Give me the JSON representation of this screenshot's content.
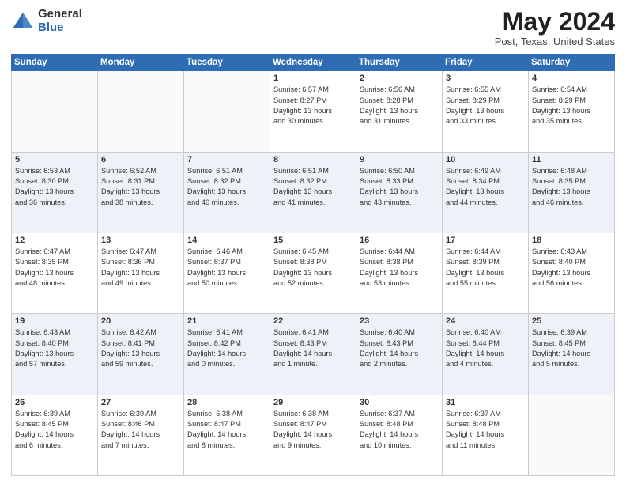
{
  "logo": {
    "general": "General",
    "blue": "Blue"
  },
  "title": {
    "month_year": "May 2024",
    "location": "Post, Texas, United States"
  },
  "days_of_week": [
    "Sunday",
    "Monday",
    "Tuesday",
    "Wednesday",
    "Thursday",
    "Friday",
    "Saturday"
  ],
  "weeks": [
    [
      {
        "day": "",
        "info": ""
      },
      {
        "day": "",
        "info": ""
      },
      {
        "day": "",
        "info": ""
      },
      {
        "day": "1",
        "info": "Sunrise: 6:57 AM\nSunset: 8:27 PM\nDaylight: 13 hours\nand 30 minutes."
      },
      {
        "day": "2",
        "info": "Sunrise: 6:56 AM\nSunset: 8:28 PM\nDaylight: 13 hours\nand 31 minutes."
      },
      {
        "day": "3",
        "info": "Sunrise: 6:55 AM\nSunset: 8:29 PM\nDaylight: 13 hours\nand 33 minutes."
      },
      {
        "day": "4",
        "info": "Sunrise: 6:54 AM\nSunset: 8:29 PM\nDaylight: 13 hours\nand 35 minutes."
      }
    ],
    [
      {
        "day": "5",
        "info": "Sunrise: 6:53 AM\nSunset: 8:30 PM\nDaylight: 13 hours\nand 36 minutes."
      },
      {
        "day": "6",
        "info": "Sunrise: 6:52 AM\nSunset: 8:31 PM\nDaylight: 13 hours\nand 38 minutes."
      },
      {
        "day": "7",
        "info": "Sunrise: 6:51 AM\nSunset: 8:32 PM\nDaylight: 13 hours\nand 40 minutes."
      },
      {
        "day": "8",
        "info": "Sunrise: 6:51 AM\nSunset: 8:32 PM\nDaylight: 13 hours\nand 41 minutes."
      },
      {
        "day": "9",
        "info": "Sunrise: 6:50 AM\nSunset: 8:33 PM\nDaylight: 13 hours\nand 43 minutes."
      },
      {
        "day": "10",
        "info": "Sunrise: 6:49 AM\nSunset: 8:34 PM\nDaylight: 13 hours\nand 44 minutes."
      },
      {
        "day": "11",
        "info": "Sunrise: 6:48 AM\nSunset: 8:35 PM\nDaylight: 13 hours\nand 46 minutes."
      }
    ],
    [
      {
        "day": "12",
        "info": "Sunrise: 6:47 AM\nSunset: 8:35 PM\nDaylight: 13 hours\nand 48 minutes."
      },
      {
        "day": "13",
        "info": "Sunrise: 6:47 AM\nSunset: 8:36 PM\nDaylight: 13 hours\nand 49 minutes."
      },
      {
        "day": "14",
        "info": "Sunrise: 6:46 AM\nSunset: 8:37 PM\nDaylight: 13 hours\nand 50 minutes."
      },
      {
        "day": "15",
        "info": "Sunrise: 6:45 AM\nSunset: 8:38 PM\nDaylight: 13 hours\nand 52 minutes."
      },
      {
        "day": "16",
        "info": "Sunrise: 6:44 AM\nSunset: 8:38 PM\nDaylight: 13 hours\nand 53 minutes."
      },
      {
        "day": "17",
        "info": "Sunrise: 6:44 AM\nSunset: 8:39 PM\nDaylight: 13 hours\nand 55 minutes."
      },
      {
        "day": "18",
        "info": "Sunrise: 6:43 AM\nSunset: 8:40 PM\nDaylight: 13 hours\nand 56 minutes."
      }
    ],
    [
      {
        "day": "19",
        "info": "Sunrise: 6:43 AM\nSunset: 8:40 PM\nDaylight: 13 hours\nand 57 minutes."
      },
      {
        "day": "20",
        "info": "Sunrise: 6:42 AM\nSunset: 8:41 PM\nDaylight: 13 hours\nand 59 minutes."
      },
      {
        "day": "21",
        "info": "Sunrise: 6:41 AM\nSunset: 8:42 PM\nDaylight: 14 hours\nand 0 minutes."
      },
      {
        "day": "22",
        "info": "Sunrise: 6:41 AM\nSunset: 8:43 PM\nDaylight: 14 hours\nand 1 minute."
      },
      {
        "day": "23",
        "info": "Sunrise: 6:40 AM\nSunset: 8:43 PM\nDaylight: 14 hours\nand 2 minutes."
      },
      {
        "day": "24",
        "info": "Sunrise: 6:40 AM\nSunset: 8:44 PM\nDaylight: 14 hours\nand 4 minutes."
      },
      {
        "day": "25",
        "info": "Sunrise: 6:39 AM\nSunset: 8:45 PM\nDaylight: 14 hours\nand 5 minutes."
      }
    ],
    [
      {
        "day": "26",
        "info": "Sunrise: 6:39 AM\nSunset: 8:45 PM\nDaylight: 14 hours\nand 6 minutes."
      },
      {
        "day": "27",
        "info": "Sunrise: 6:39 AM\nSunset: 8:46 PM\nDaylight: 14 hours\nand 7 minutes."
      },
      {
        "day": "28",
        "info": "Sunrise: 6:38 AM\nSunset: 8:47 PM\nDaylight: 14 hours\nand 8 minutes."
      },
      {
        "day": "29",
        "info": "Sunrise: 6:38 AM\nSunset: 8:47 PM\nDaylight: 14 hours\nand 9 minutes."
      },
      {
        "day": "30",
        "info": "Sunrise: 6:37 AM\nSunset: 8:48 PM\nDaylight: 14 hours\nand 10 minutes."
      },
      {
        "day": "31",
        "info": "Sunrise: 6:37 AM\nSunset: 8:48 PM\nDaylight: 14 hours\nand 11 minutes."
      },
      {
        "day": "",
        "info": ""
      }
    ]
  ]
}
